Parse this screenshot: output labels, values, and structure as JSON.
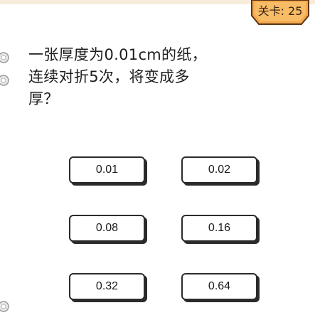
{
  "level": {
    "text": "关卡: 25"
  },
  "question": {
    "lines": [
      "一张厚度为0.01cm的纸，",
      "连续对折5次，将变成多",
      "厚？"
    ]
  },
  "answers": [
    {
      "label": "0.01"
    },
    {
      "label": "0.02"
    },
    {
      "label": "0.08"
    },
    {
      "label": "0.16"
    },
    {
      "label": "0.32"
    },
    {
      "label": "0.64"
    }
  ],
  "colors": {
    "badge_fill": "#f5a84a",
    "badge_border": "#5a3515",
    "button_border": "#2b2b2b",
    "text": "#1e1e1e"
  }
}
